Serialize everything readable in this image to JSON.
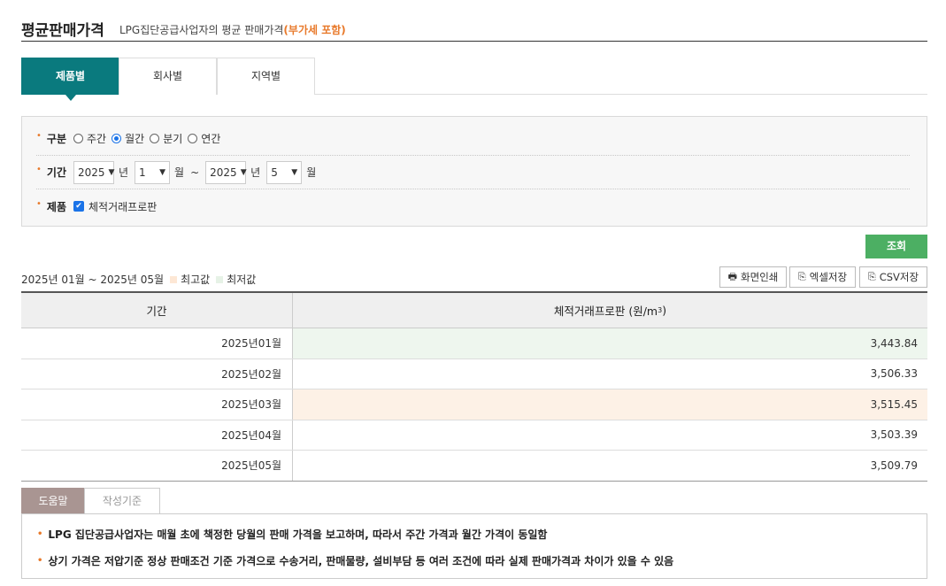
{
  "header": {
    "title": "평균판매가격",
    "subtitle": "LPG집단공급사업자의 평균 판매가격",
    "vat_note": "(부가세 포함)"
  },
  "tabs": [
    {
      "label": "제품별",
      "active": true
    },
    {
      "label": "회사별",
      "active": false
    },
    {
      "label": "지역별",
      "active": false
    }
  ],
  "filter": {
    "period_type": {
      "label": "구분",
      "options": [
        {
          "label": "주간",
          "checked": false
        },
        {
          "label": "월간",
          "checked": true
        },
        {
          "label": "분기",
          "checked": false
        },
        {
          "label": "연간",
          "checked": false
        }
      ]
    },
    "range": {
      "label": "기간",
      "from_year": "2025",
      "from_month": "1",
      "to_year": "2025",
      "to_month": "5",
      "year_unit": "년",
      "month_unit": "월",
      "tilde": "~"
    },
    "product": {
      "label": "제품",
      "checkbox_label": "체적거래프로판",
      "checked": true
    }
  },
  "search_button": "조회",
  "result": {
    "period_text": "2025년 01월 ~ 2025년 05월",
    "legend_max": "최고값",
    "legend_min": "최저값",
    "legend_max_color": "#fde7d5",
    "legend_min_color": "#e6f2e6"
  },
  "tools": {
    "print": "화면인쇄",
    "excel": "엑셀저장",
    "csv": "CSV저장"
  },
  "table": {
    "col1": "기간",
    "col2": "체적거래프로판 (원/m",
    "col2_sup": "3",
    "col2_close": ")",
    "rows": [
      {
        "period": "2025년01월",
        "value": "3,443.84",
        "mark": "min"
      },
      {
        "period": "2025년02월",
        "value": "3,506.33",
        "mark": ""
      },
      {
        "period": "2025년03월",
        "value": "3,515.45",
        "mark": "max"
      },
      {
        "period": "2025년04월",
        "value": "3,503.39",
        "mark": ""
      },
      {
        "period": "2025년05월",
        "value": "3,509.79",
        "mark": ""
      }
    ]
  },
  "help_tabs": [
    {
      "label": "도움말",
      "active": true
    },
    {
      "label": "작성기준",
      "active": false
    }
  ],
  "help_lines": [
    "LPG 집단공급사업자는 매월 초에 책정한 당월의 판매 가격을 보고하며, 따라서 주간 가격과 월간 가격이 동일함",
    "상기 가격은 저압기준 정상 판매조건 기준 가격으로 수송거리, 판매물량, 설비부담 등 여러 조건에 따라 실제 판매가격과 차이가 있을 수 있음"
  ]
}
